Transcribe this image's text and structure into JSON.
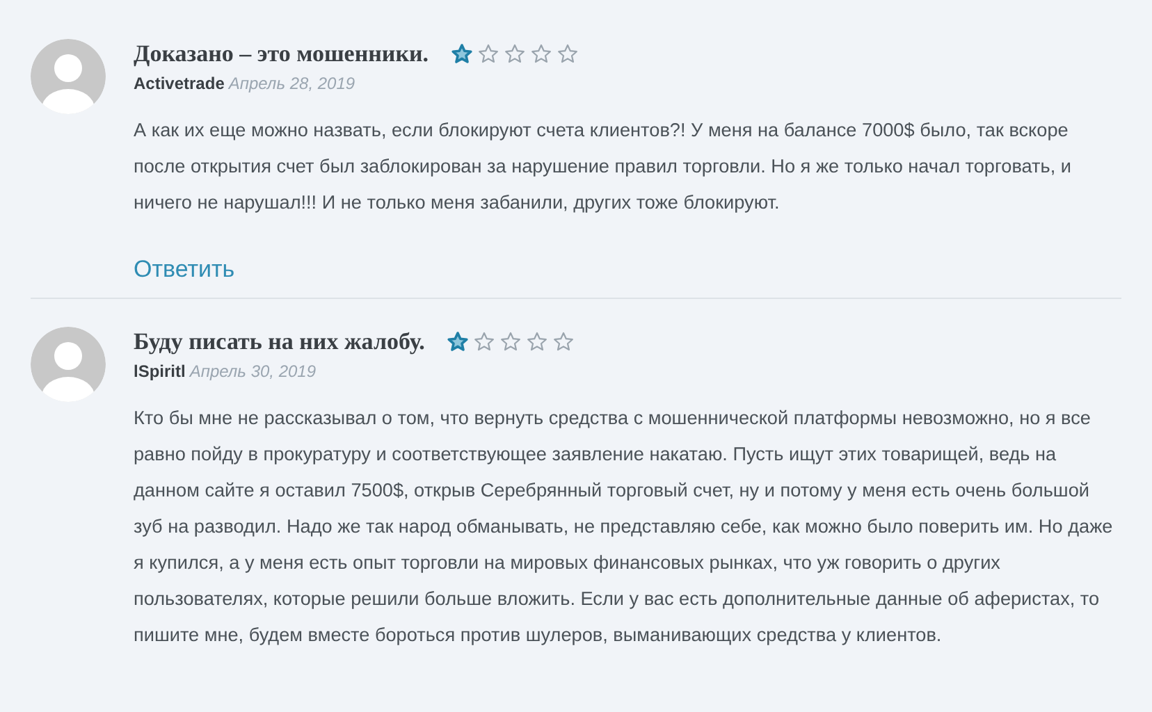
{
  "reviews": [
    {
      "title": "Доказано – это мошенники.",
      "stars": 1,
      "author": "Activetrade",
      "date": "Апрель 28, 2019",
      "text": "А как их еще можно назвать, если блокируют счета клиентов?! У меня на балансе 7000$ было, так вскоре после открытия счет был заблокирован за нарушение правил торговли. Но я же только начал торговать, и ничего не нарушал!!! И не только меня забанили, других тоже блокируют.",
      "reply": "Ответить"
    },
    {
      "title": "Буду писать на них жалобу.",
      "stars": 1,
      "author": "lSpiritl",
      "date": "Апрель 30, 2019",
      "text": "Кто бы мне не рассказывал о том, что вернуть средства с мошеннической платформы невозможно, но я все равно пойду в прокуратуру и соответствующее заявление накатаю. Пусть ищут этих товарищей, ведь на данном сайте я оставил 7500$, открыв Серебрянный торговый счет, ну и потому у меня есть очень большой зуб на разводил. Надо же так народ обманывать, не представляю себе, как можно было поверить им. Но даже я купился, а у меня есть опыт торговли на мировых финансовых рынках, что уж говорить о других пользователях, которые решили больше вложить. Если у вас есть дополнительные данные об аферистах, то пишите мне, будем вместе бороться против шулеров, выманивающих средства у клиентов."
    }
  ]
}
